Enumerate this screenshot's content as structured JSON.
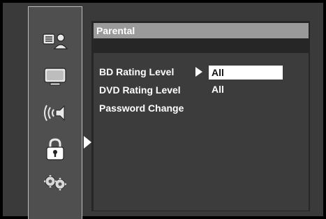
{
  "panel": {
    "title": "Parental"
  },
  "sidebar": {
    "items": [
      {
        "icon": "playback-setup-icon"
      },
      {
        "icon": "display-tv-icon"
      },
      {
        "icon": "audio-speaker-icon"
      },
      {
        "icon": "lock-icon",
        "selected": true
      },
      {
        "icon": "settings-gears-icon"
      }
    ]
  },
  "settings": [
    {
      "label": "BD Rating Level",
      "value": "All",
      "selected": true
    },
    {
      "label": "DVD Rating Level",
      "value": "All",
      "selected": false
    },
    {
      "label": "Password Change",
      "value": "",
      "selected": false
    }
  ],
  "colors": {
    "background": "#000000",
    "frame": "#3a3a3a",
    "sidebar": "#4f4f4f",
    "header": "#9a9a9a",
    "body": "#3c3c3c",
    "highlight": "#ffffff"
  }
}
